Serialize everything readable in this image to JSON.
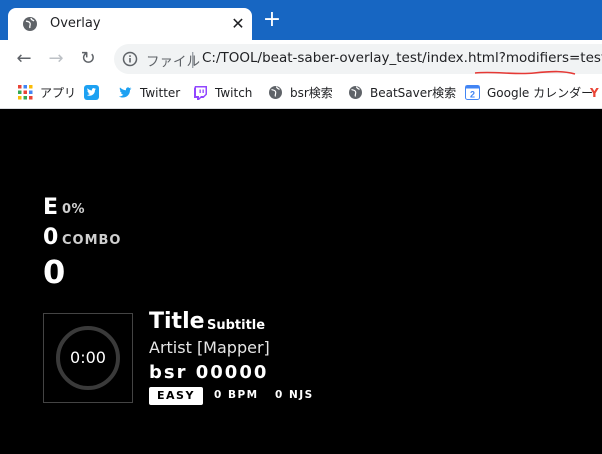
{
  "browser": {
    "tab_title": "Overlay",
    "tab_close": "✕",
    "new_tab": "+",
    "back": "←",
    "forward": "→",
    "reload": "↻",
    "scheme_label": "ファイル",
    "separator": "|",
    "url": "C:/TOOL/beat-saber-overlay_test/index.html?modifiers=test",
    "annotation_color": "#e53935"
  },
  "bookmarks": [
    {
      "label": "アプリ",
      "icon": "apps-icon"
    },
    {
      "label": "",
      "icon": "twitter-blue-square-icon"
    },
    {
      "label": "Twitter",
      "icon": "twitter-bird-icon"
    },
    {
      "label": "Twitch",
      "icon": "twitch-icon"
    },
    {
      "label": "bsr検索",
      "icon": "globe-icon"
    },
    {
      "label": "BeatSaver検索",
      "icon": "globe-icon"
    },
    {
      "label": "Google カレンダー",
      "icon": "google-calendar-icon"
    },
    {
      "label": "Y",
      "icon": "youtube-icon"
    }
  ],
  "overlay": {
    "rank": "E",
    "percentage": "0%",
    "combo": "0",
    "combo_label": "COMBO",
    "score": "0",
    "timer": "0:00",
    "title": "Title",
    "subtitle": "Subtitle",
    "artist": "Artist [Mapper]",
    "bsr": "bsr 00000",
    "difficulty": "EASY",
    "bpm": "0 BPM",
    "njs": "0 NJS"
  },
  "colors": {
    "titlebar": "#1766c2",
    "overlay_bg": "#000000",
    "text": "#ffffff"
  }
}
